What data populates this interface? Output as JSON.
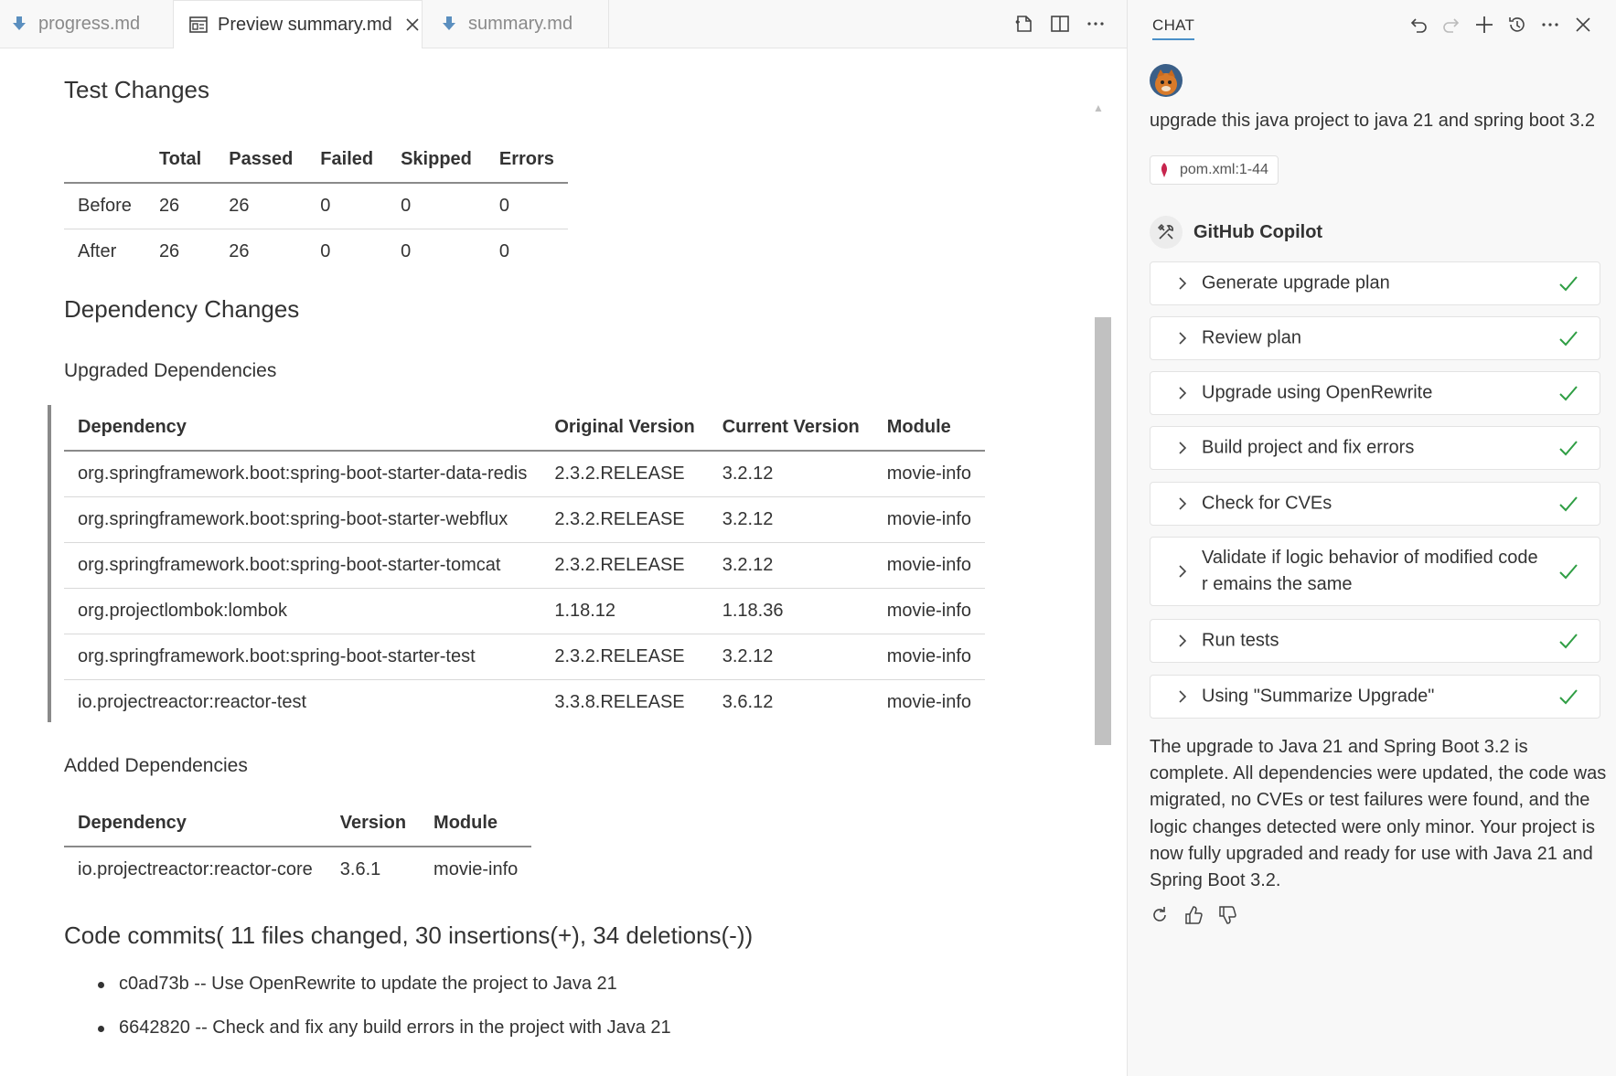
{
  "tabs": [
    {
      "label": "progress.md",
      "icon": "markdown-download-icon"
    },
    {
      "label": "Preview summary.md",
      "icon": "preview-icon",
      "active": true
    },
    {
      "label": "summary.md",
      "icon": "markdown-download-icon"
    }
  ],
  "preview": {
    "test_changes": {
      "heading": "Test Changes",
      "headers": [
        "",
        "Total",
        "Passed",
        "Failed",
        "Skipped",
        "Errors"
      ],
      "rows": [
        [
          "Before",
          "26",
          "26",
          "0",
          "0",
          "0"
        ],
        [
          "After",
          "26",
          "26",
          "0",
          "0",
          "0"
        ]
      ]
    },
    "dependency_changes": {
      "heading": "Dependency Changes",
      "upgraded": {
        "heading": "Upgraded Dependencies",
        "headers": [
          "Dependency",
          "Original Version",
          "Current Version",
          "Module"
        ],
        "rows": [
          [
            "org.springframework.boot:spring-boot-starter-data-redis",
            "2.3.2.RELEASE",
            "3.2.12",
            "movie-info"
          ],
          [
            "org.springframework.boot:spring-boot-starter-webflux",
            "2.3.2.RELEASE",
            "3.2.12",
            "movie-info"
          ],
          [
            "org.springframework.boot:spring-boot-starter-tomcat",
            "2.3.2.RELEASE",
            "3.2.12",
            "movie-info"
          ],
          [
            "org.projectlombok:lombok",
            "1.18.12",
            "1.18.36",
            "movie-info"
          ],
          [
            "org.springframework.boot:spring-boot-starter-test",
            "2.3.2.RELEASE",
            "3.2.12",
            "movie-info"
          ],
          [
            "io.projectreactor:reactor-test",
            "3.3.8.RELEASE",
            "3.6.12",
            "movie-info"
          ]
        ]
      },
      "added": {
        "heading": "Added Dependencies",
        "headers": [
          "Dependency",
          "Version",
          "Module"
        ],
        "rows": [
          [
            "io.projectreactor:reactor-core",
            "3.6.1",
            "movie-info"
          ]
        ]
      }
    },
    "commits": {
      "heading": "Code commits( 11 files changed, 30 insertions(+), 34 deletions(-))",
      "items": [
        "c0ad73b -- Use OpenRewrite to update the project to Java 21",
        "6642820 -- Check and fix any build errors in the project with Java 21"
      ]
    }
  },
  "chat": {
    "title": "CHAT",
    "user_message": "upgrade this java project to java 21 and spring boot 3.2",
    "reference": "pom.xml:1-44",
    "assistant_name": "GitHub Copilot",
    "steps": [
      "Generate upgrade plan",
      "Review plan",
      "Upgrade using OpenRewrite",
      "Build project and fix errors",
      "Check for CVEs",
      "Validate if logic behavior of modified code r emains the same",
      "Run tests",
      "Using \"Summarize Upgrade\""
    ],
    "result": "The upgrade to Java 21 and Spring Boot 3.2 is complete. All dependencies were updated, the code was migrated, no CVEs or test failures were found, and the logic changes detected were only minor. Your project is now fully upgraded and ready for use with Java 21 and Spring Boot 3.2."
  },
  "colors": {
    "accent": "#4a90c8",
    "check": "#2f9e44",
    "markdown_icon": "#5b8fbf"
  }
}
